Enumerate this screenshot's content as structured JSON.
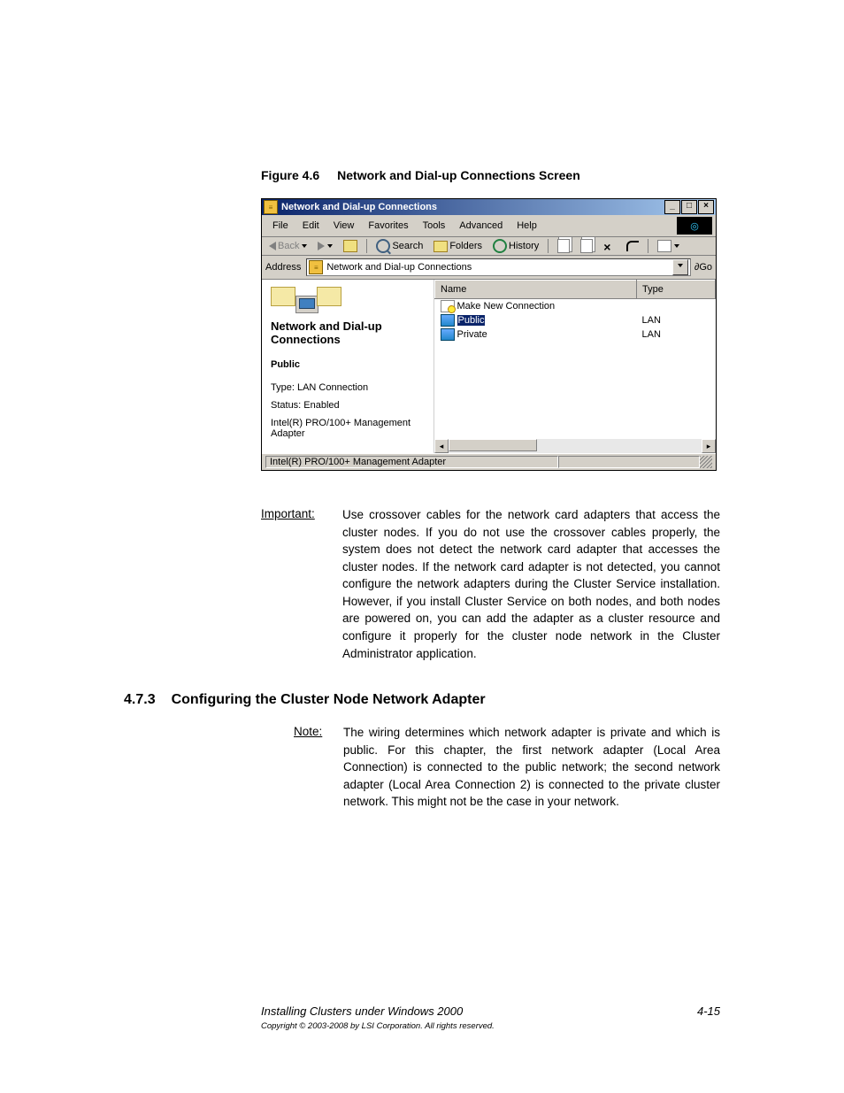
{
  "figure": {
    "label": "Figure 4.6",
    "title": "Network and Dial-up Connections Screen"
  },
  "window": {
    "title": "Network and Dial-up Connections",
    "menu": {
      "file": "File",
      "edit": "Edit",
      "view": "View",
      "favorites": "Favorites",
      "tools": "Tools",
      "advanced": "Advanced",
      "help": "Help"
    },
    "toolbar": {
      "back": "Back",
      "search": "Search",
      "folders": "Folders",
      "history": "History"
    },
    "address": {
      "label": "Address",
      "value": "Network and Dial-up Connections",
      "go": "Go"
    },
    "leftpane": {
      "heading": "Network and Dial-up Connections",
      "selected": "Public",
      "type_line": "Type: LAN Connection",
      "status_line": "Status: Enabled",
      "device_line": "Intel(R) PRO/100+ Management Adapter"
    },
    "columns": {
      "name": "Name",
      "type": "Type"
    },
    "rows": [
      {
        "name": "Make New Connection",
        "type": ""
      },
      {
        "name": "Public",
        "type": "LAN",
        "selected": true
      },
      {
        "name": "Private",
        "type": "LAN"
      }
    ],
    "statusbar": "Intel(R) PRO/100+ Management Adapter"
  },
  "important": {
    "label": "Important:",
    "text": "Use crossover cables for the network card adapters that access the cluster nodes. If you do not use the crossover cables properly, the system does not detect the network card adapter that accesses the cluster nodes. If the network card adapter is not detected, you cannot configure the network adapters during the Cluster Service installation. However, if you install Cluster Service on both nodes, and both nodes are powered on, you can add the adapter as a cluster resource and configure it properly for the cluster node network in the Cluster Administrator application."
  },
  "section": {
    "number": "4.7.3",
    "title": "Configuring the Cluster Node Network Adapter"
  },
  "note": {
    "label": "Note:",
    "text": "The wiring determines which network adapter is private and which is public. For this chapter, the first network adapter (Local Area Connection) is connected to the public network; the second network adapter (Local Area Connection 2) is connected to the private cluster network. This might not be the case in your network."
  },
  "footer": {
    "left": "Installing Clusters under Windows 2000",
    "right": "4-15",
    "copyright": "Copyright © 2003-2008 by LSI Corporation. All rights reserved."
  }
}
